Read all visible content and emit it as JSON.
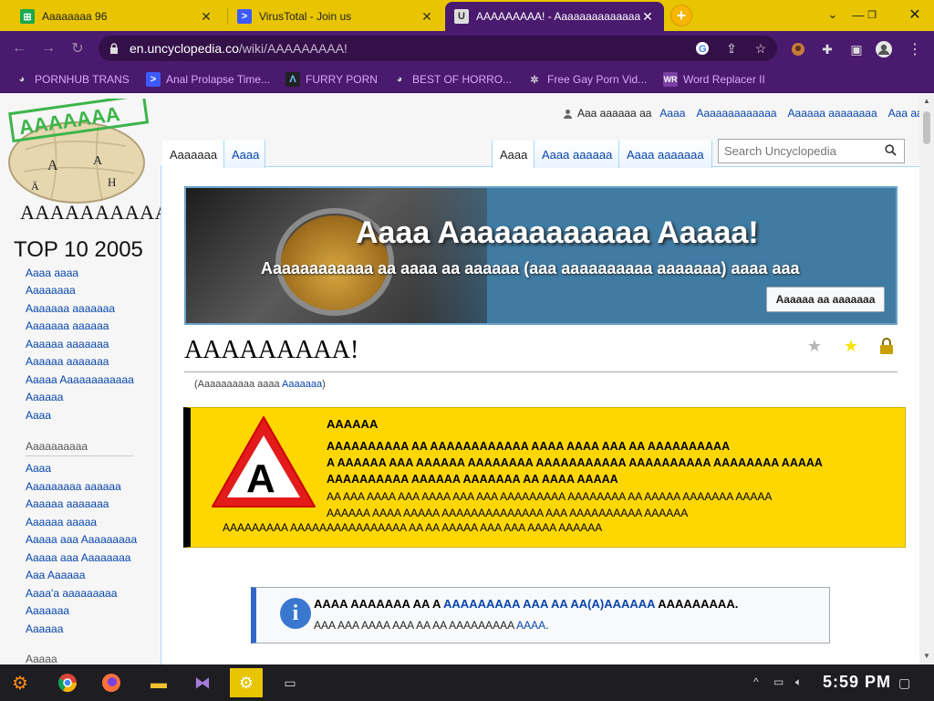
{
  "browser": {
    "tabs": [
      {
        "title": "Aaaaaaaa 96",
        "active": false
      },
      {
        "title": "VirusTotal - Join us",
        "active": false
      },
      {
        "title": "AAAAAAAAA! - Aaaaaaaaaaaaaaa",
        "active": true
      }
    ],
    "new_tab_label": "+",
    "url_domain": "en.uncyclopedia.co",
    "url_path": "/wiki/AAAAAAAAA!",
    "bookmarks": [
      "PORNHUB TRANS",
      "Anal Prolapse Time...",
      "FURRY PORN",
      "BEST OF HORRO...",
      "Free Gay Porn Vid...",
      "Word Replacer II"
    ]
  },
  "site": {
    "logo_badge": "AAAAAAA",
    "logo_text": "AAAAAAAAAAA",
    "personal_user": "Aaa aaaaaa aa",
    "personal_links": [
      "Aaaa",
      "Aaaaaaaaaaaaa",
      "Aaaaaa aaaaaaaa",
      "Aaa aa"
    ],
    "left_tabs": [
      "Aaaaaaa",
      "Aaaa"
    ],
    "right_tabs": [
      "Aaaa",
      "Aaaa aaaaaa",
      "Aaaa aaaaaaa"
    ],
    "search_placeholder": "Search Uncyclopedia"
  },
  "sidebar": {
    "top10": "TOP 10 2005",
    "links1": [
      "Aaaa aaaa",
      "Aaaaaaaa",
      "Aaaaaaa aaaaaaa",
      "Aaaaaaa aaaaaa",
      "Aaaaaa aaaaaaa",
      "Aaaaaa aaaaaaa",
      "Aaaaa Aaaaaaaaaaaa",
      "Aaaaaa",
      "Aaaa"
    ],
    "heading2": "Aaaaaaaaaa",
    "links2": [
      "Aaaa",
      "Aaaaaaaaa aaaaaa",
      "Aaaaaa aaaaaaa",
      "Aaaaaa aaaaa",
      "Aaaaa aaa Aaaaaaaaa",
      "Aaaaa aaa Aaaaaaaa",
      "Aaa Aaaaaa",
      "Aaaa'a aaaaaaaaa",
      "Aaaaaaa",
      "Aaaaaa"
    ],
    "heading3": "Aaaaa"
  },
  "banner": {
    "title": "Aaaa Aaaaaaaaaaaa Aaaaa!",
    "subtitle": "Aaaaaaaaaaaa aa aaaa aa aaaaaa (aaa aaaaaaaaaa aaaaaaa) aaaa aaa",
    "button": "Aaaaaa aa aaaaaaa"
  },
  "article": {
    "title": "AAAAAAAAA!",
    "subtitle_prefix": "(Aaaaaaaaaa aaaa ",
    "subtitle_link": "Aaaaaaa",
    "subtitle_suffix": ")"
  },
  "warning": {
    "sign_letter": "A",
    "title": "AAAAAA",
    "bold_lines": [
      "AAAAAAAAAA AA AAAAAAAAAAAA AAAA AAAA AAA AA AAAAAAAAAA",
      "A AAAAAA AAA AAAAAA AAAAAAAA AAAAAAAAAAA AAAAAAAAAA AAAAAAAA AAAAA",
      "AAAAAAAAAA AAAAAA AAAAAAA AA AAAA AAAAA"
    ],
    "normal_lines": [
      "AA AAA AAAA AAA AAAA AAA AAA AAAAAAAAA AAAAAAAA AA AAAAA AAAAAAA AAAAA",
      "AAAAAA AAAA AAAAA AAAAAAAAAAAAAA AAA AAAAAAAAAA AAAAAA"
    ],
    "last_line": "AAAAAAAAA AAAAAAAAAAAAAAAA AA AA AAAAA AAA AAA AAAA AAAAAA"
  },
  "notice": {
    "icon_letter": "i",
    "line1_prefix": "AAAA AAAAAAA AA A ",
    "line1_link": "AAAAAAAAA AAA AA AA(A)AAAAAA",
    "line1_suffix": " AAAAAAAAA.",
    "line2_prefix": "AAA AAA AAAA AAA AA AA AAAAAAAAA ",
    "line2_link": "AAAA",
    "line2_suffix": "."
  },
  "taskbar": {
    "clock": "5:59 PM"
  },
  "colors": {
    "tab_strip": "#e8c500",
    "browser_purple": "#4a1a6e",
    "bookmark_text": "#d9a6ff",
    "link": "#0645ad",
    "warning_bg": "#ffd700"
  }
}
